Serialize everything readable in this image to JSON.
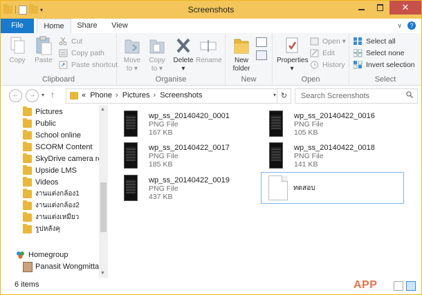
{
  "window": {
    "title": "Screenshots"
  },
  "ribbon_tabs": [
    "File",
    "Home",
    "Share",
    "View"
  ],
  "ribbon": {
    "clipboard": {
      "copy": "Copy",
      "paste": "Paste",
      "cut": "Cut",
      "copy_path": "Copy path",
      "paste_shortcut": "Paste shortcut",
      "label": "Clipboard"
    },
    "organise": {
      "move_to_1": "Move",
      "move_to_2": "to",
      "copy_to_1": "Copy",
      "copy_to_2": "to",
      "delete": "Delete",
      "rename": "Rename",
      "label": "Organise"
    },
    "new": {
      "new_folder_1": "New",
      "new_folder_2": "folder",
      "label": "New"
    },
    "open": {
      "properties": "Properties",
      "open": "Open",
      "edit": "Edit",
      "history": "History",
      "label": "Open"
    },
    "select": {
      "select_all": "Select all",
      "select_none": "Select none",
      "invert_selection": "Invert selection",
      "label": "Select"
    }
  },
  "address": {
    "overflow": "«",
    "breadcrumbs": [
      "Phone",
      "Pictures",
      "Screenshots"
    ]
  },
  "search": {
    "placeholder": "Search Screenshots"
  },
  "nav_pane": {
    "folders": [
      "Pictures",
      "Public",
      "School online",
      "SCORM Content",
      "SkyDrive camera roll",
      "Upside LMS",
      "Videos",
      "งานแต่งกล้อง1",
      "งานแต่งกล้อง2",
      "งานแต่งเหมียว",
      "รูปหลังคุ"
    ],
    "homegroup": "Homegroup",
    "homegroup_user": "Panasit Wongmittae"
  },
  "files": [
    {
      "name": "wp_ss_20140420_0001",
      "type": "PNG File",
      "size": "167 KB"
    },
    {
      "name": "wp_ss_20140422_0016",
      "type": "PNG File",
      "size": "105 KB"
    },
    {
      "name": "wp_ss_20140422_0017",
      "type": "PNG File",
      "size": "185 KB"
    },
    {
      "name": "wp_ss_20140422_0018",
      "type": "PNG File",
      "size": "141 KB"
    },
    {
      "name": "wp_ss_20140422_0019",
      "type": "PNG File",
      "size": "437 KB"
    },
    {
      "name": "ทดสอบ",
      "type": "",
      "size": ""
    }
  ],
  "status": {
    "item_count": "6 items",
    "watermark": "APP"
  },
  "colors": {
    "titlebar": "#f3c55a",
    "file_tab": "#1979ca",
    "close_button": "#c7504b",
    "folder": "#e8b73c",
    "selection_border": "#7eb4ea"
  }
}
